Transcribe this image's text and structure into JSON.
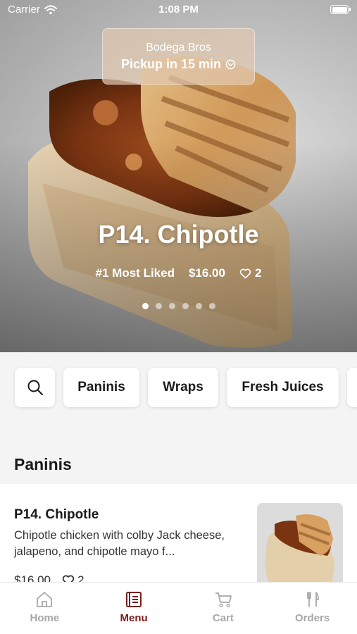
{
  "status_bar": {
    "carrier": "Carrier",
    "time": "1:08 PM"
  },
  "pickup": {
    "store": "Bodega Bros",
    "time": "Pickup in 15 min"
  },
  "hero": {
    "title": "P14. Chipotle",
    "badge": "#1 Most Liked",
    "price": "$16.00",
    "likes": "2",
    "carousel": {
      "count": 6,
      "active": 1
    }
  },
  "categories": {
    "search_icon": "search-icon",
    "items": [
      "Paninis",
      "Wraps",
      "Fresh Juices"
    ]
  },
  "section": {
    "title": "Paninis"
  },
  "menu_item": {
    "name": "P14. Chipotle",
    "description": "Chipotle chicken with colby Jack cheese, jalapeno, and chipotle mayo f...",
    "price": "$16.00",
    "likes": "2"
  },
  "tabbar": {
    "home": "Home",
    "menu": "Menu",
    "cart": "Cart",
    "orders": "Orders",
    "active": "Menu"
  },
  "colors": {
    "accent": "#7c1f1f",
    "inactive": "#a8a8a8"
  }
}
